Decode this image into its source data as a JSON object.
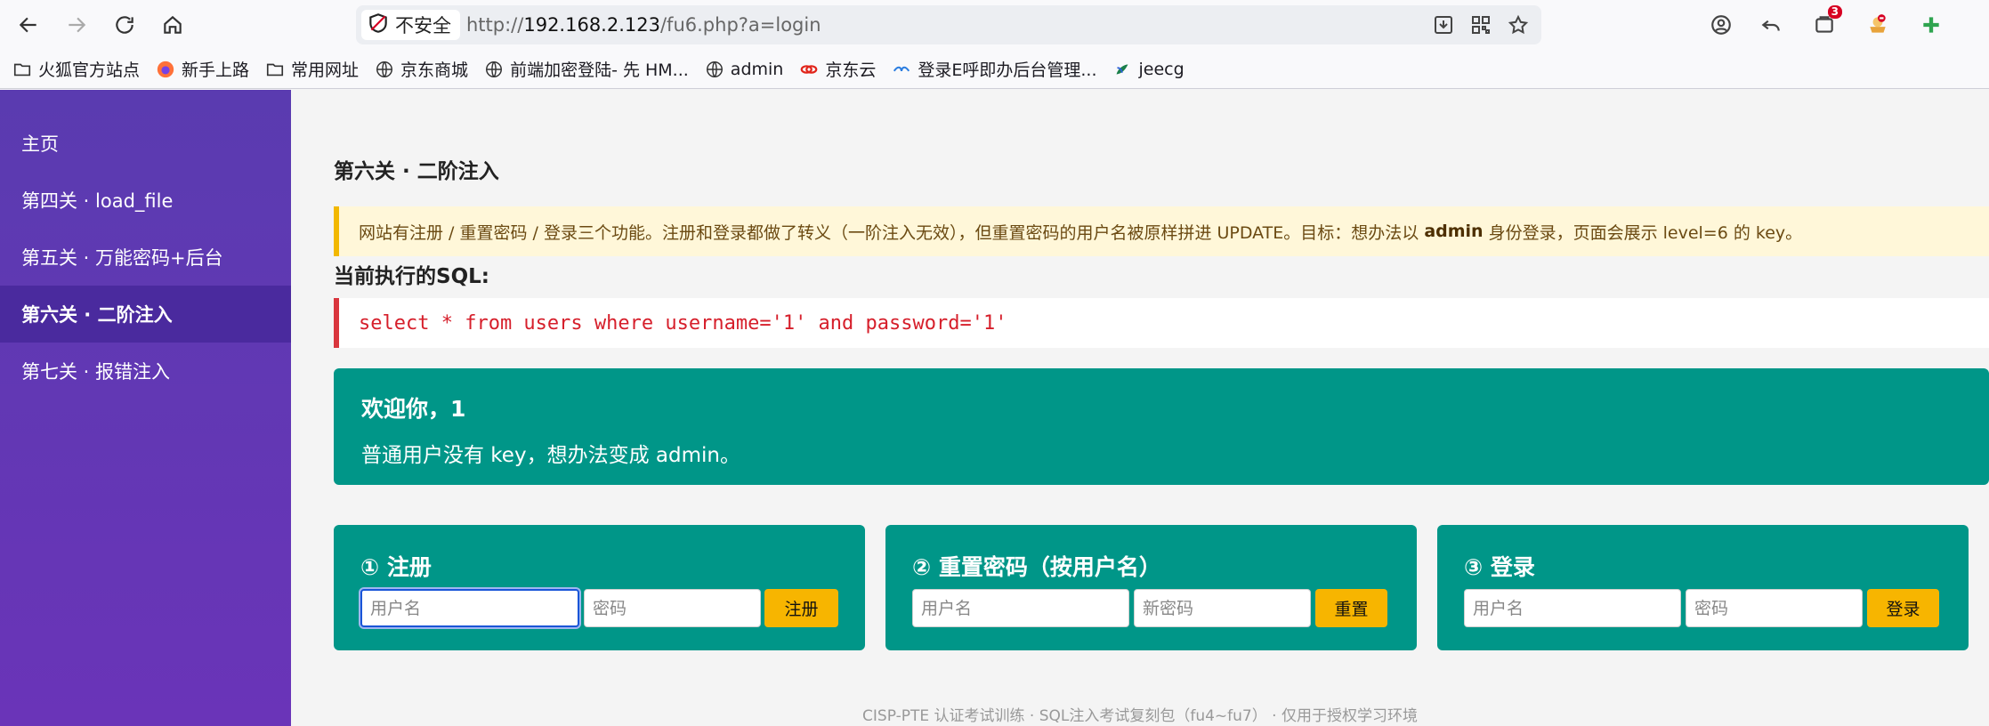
{
  "browser": {
    "security_label": "不安全",
    "url_prefix": "http://",
    "url_host": "192.168.2.123",
    "url_path": "/fu6.php?a=login",
    "notification_count": "3"
  },
  "bookmarks": [
    {
      "label": "火狐官方站点",
      "icon": "folder-icon"
    },
    {
      "label": "新手上路",
      "icon": "firefox-icon"
    },
    {
      "label": "常用网址",
      "icon": "folder-icon"
    },
    {
      "label": "京东商城",
      "icon": "globe-icon"
    },
    {
      "label": "前端加密登陆- 先 HM...",
      "icon": "globe-icon"
    },
    {
      "label": "admin",
      "icon": "globe-icon"
    },
    {
      "label": "京东云",
      "icon": "jdcloud-icon"
    },
    {
      "label": "登录E呼即办后台管理...",
      "icon": "site-icon"
    },
    {
      "label": "jeecg",
      "icon": "jeecg-icon"
    }
  ],
  "sidebar": {
    "items": [
      {
        "label": "主页"
      },
      {
        "label": "第四关 · load_file"
      },
      {
        "label": "第五关 · 万能密码+后台"
      },
      {
        "label": "第六关 · 二阶注入"
      },
      {
        "label": "第七关 · 报错注入"
      }
    ]
  },
  "main": {
    "title": "第六关 · 二阶注入",
    "notice_before": "网站有注册 / 重置密码 / 登录三个功能。注册和登录都做了转义（一阶注入无效），但重置密码的用户名被原样拼进 UPDATE。目标：想办法以",
    "notice_bold": "admin",
    "notice_after": "身份登录，页面会展示 level=6 的 key。",
    "sql_label": "当前执行的SQL:",
    "sql": "select * from users where username='1' and password='1'",
    "welcome_title": "欢迎你，1",
    "welcome_text": "普通用户没有 key，想办法变成 admin。"
  },
  "register": {
    "title": "① 注册",
    "username_placeholder": "用户名",
    "password_placeholder": "密码",
    "button": "注册"
  },
  "reset": {
    "title": "② 重置密码（按用户名）",
    "username_placeholder": "用户名",
    "password_placeholder": "新密码",
    "button": "重置"
  },
  "login": {
    "title": "③ 登录",
    "username_placeholder": "用户名",
    "password_placeholder": "密码",
    "button": "登录"
  },
  "footer": "CISP-PTE 认证考试训练 · SQL注入考试复刻包（fu4~fu7） · 仅用于授权学习环境",
  "colors": {
    "sidebar": "#5a3bb0",
    "teal": "#009688",
    "button": "#f7b500",
    "sql_text": "#d61f2b"
  }
}
